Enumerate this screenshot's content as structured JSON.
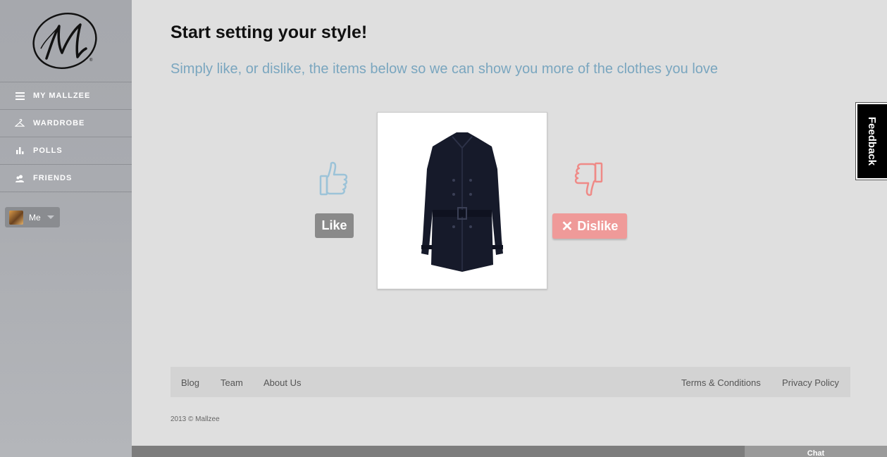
{
  "sidebar": {
    "logo_icon": "mallzee-m-logo",
    "items": [
      {
        "label": "MY MALLZEE",
        "icon": "menu-icon"
      },
      {
        "label": "WARDROBE",
        "icon": "hanger-icon"
      },
      {
        "label": "POLLS",
        "icon": "bar-chart-icon"
      },
      {
        "label": "FRIENDS",
        "icon": "people-icon"
      }
    ],
    "user_label": "Me"
  },
  "main": {
    "title": "Start setting your style!",
    "subtitle": "Simply like, or dislike, the items below so we can show you more of the clothes you love",
    "like_label": "Like",
    "dislike_label": "Dislike",
    "product_icon": "trench-coat-image",
    "colors": {
      "subtitle": "#7aa6bf",
      "like": "#8a8a8a",
      "dislike": "#ef9a99",
      "thumb_up": "#9cc3d8",
      "thumb_down": "#ef8a87"
    }
  },
  "feedback_label": "Feedback",
  "footer": {
    "left_links": [
      "Blog",
      "Team",
      "About Us"
    ],
    "right_links": [
      "Terms & Conditions",
      "Privacy Policy"
    ],
    "copyright": "2013 © Mallzee"
  },
  "chat_label": "Chat"
}
